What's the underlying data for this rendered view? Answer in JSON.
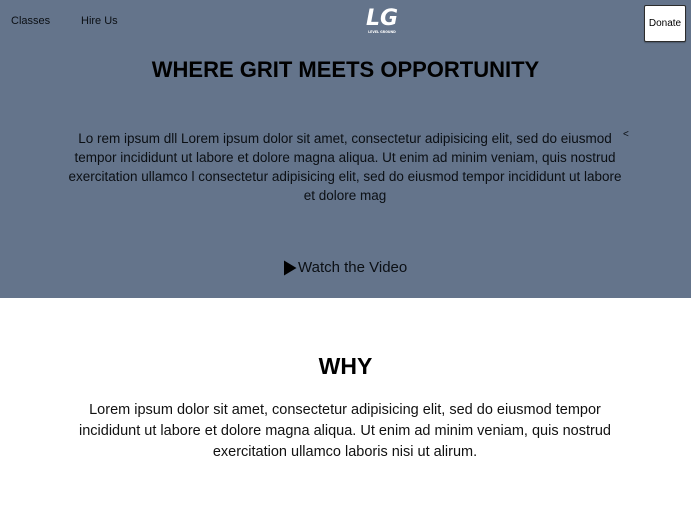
{
  "nav": {
    "classes_label": "Classes",
    "hire_label": "Hire Us",
    "logo_icon": "lg-logo-icon",
    "logo_text": "LG",
    "logo_subtext": "LEVEL GROUND",
    "donate_label": "Donate"
  },
  "hero": {
    "title": "WHERE GRIT MEETS OPPORTUNITY",
    "text": "Lo rem ipsum dll Lorem ipsum dolor sit amet, consectetur adipisicing elit, sed do eiusmod tempor incididunt ut labore et dolore magna aliqua. Ut enim ad minim veniam, quis nostrud exercitation ullamco l consectetur adipisicing elit, sed do eiusmod tempor incididunt ut labore et dolore mag",
    "caret": "<",
    "video_icon": "play-icon",
    "video_label": "Watch the Video",
    "background_color": "#64748b"
  },
  "why": {
    "title": "WHY",
    "text": "Lorem ipsum dolor sit amet, consectetur adipisicing elit, sed do eiusmod tempor incididunt ut labore et dolore magna aliqua. Ut enim ad minim veniam, quis nostrud exercitation ullamco laboris nisi ut alirum."
  }
}
